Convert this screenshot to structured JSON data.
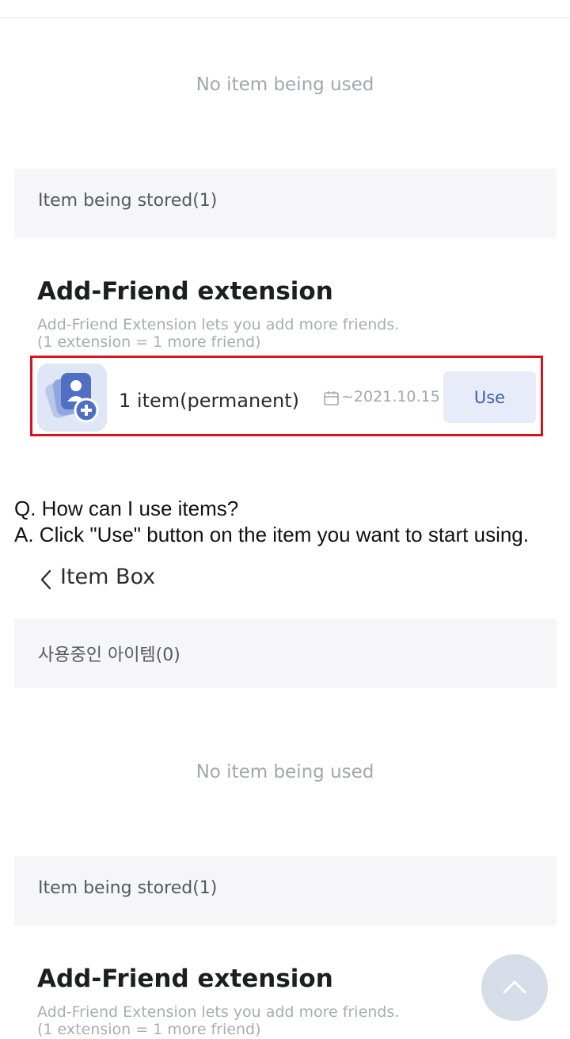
{
  "panel1": {
    "empty_text": "No item being used",
    "stored_header": "Item being stored(1)",
    "item": {
      "title": "Add-Friend extension",
      "desc_line1": "Add-Friend Extension lets you add more friends.",
      "desc_line2": "(1 extension = 1 more friend)",
      "count": "1 item(permanent)",
      "date": "~2021.10.15",
      "use_label": "Use",
      "icon": "add-friend-icon"
    }
  },
  "qa": {
    "question": "Q. How can I use items?",
    "answer": "A. Click \"Use\" button on the item you want to start using."
  },
  "panel2": {
    "back_label": "Item Box",
    "in_use_header": "사용중인 아이템(0)",
    "empty_text": "No item being used",
    "stored_header": "Item being stored(1)",
    "item": {
      "title": "Add-Friend extension",
      "desc_line1": "Add-Friend Extension lets you add more friends.",
      "desc_line2": "(1 extension = 1 more friend)"
    }
  },
  "colors": {
    "highlight": "#d9121d",
    "button_bg": "#e7ecf8",
    "button_text": "#3f5fa6",
    "section_bg": "#f6f6f8"
  }
}
